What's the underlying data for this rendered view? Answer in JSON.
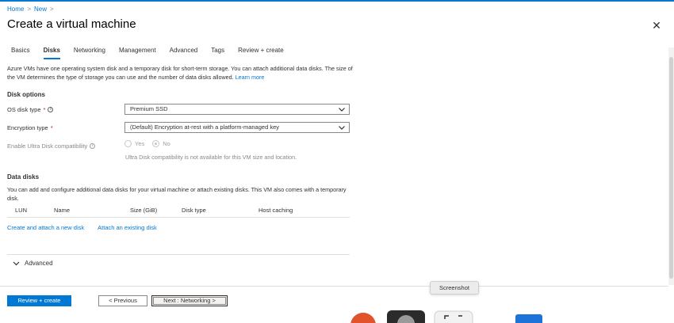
{
  "breadcrumb": {
    "items": [
      "Home",
      "New"
    ],
    "separator": ">"
  },
  "page_title": "Create a virtual machine",
  "close_symbol": "✕",
  "tabs": [
    {
      "label": "Basics",
      "active": false
    },
    {
      "label": "Disks",
      "active": true
    },
    {
      "label": "Networking",
      "active": false
    },
    {
      "label": "Management",
      "active": false
    },
    {
      "label": "Advanced",
      "active": false
    },
    {
      "label": "Tags",
      "active": false
    },
    {
      "label": "Review + create",
      "active": false
    }
  ],
  "description": {
    "text": "Azure VMs have one operating system disk and a temporary disk for short-term storage. You can attach additional data disks. The size of the VM determines the type of storage you can use and the number of data disks allowed.",
    "link": "Learn more"
  },
  "disk_options": {
    "heading": "Disk options",
    "os_disk_type": {
      "label": "OS disk type",
      "required_mark": "*",
      "value": "Premium SSD"
    },
    "encryption_type": {
      "label": "Encryption type",
      "required_mark": "*",
      "value": "(Default) Encryption at-rest with a platform-managed key"
    },
    "ultra_disk": {
      "label": "Enable Ultra Disk compatibility",
      "options": [
        "Yes",
        "No"
      ],
      "selected": "No",
      "note": "Ultra Disk compatibility is not available for this VM size and location."
    }
  },
  "data_disks": {
    "heading": "Data disks",
    "description": "You can add and configure additional data disks for your virtual machine or attach existing disks. This VM also comes with a temporary disk.",
    "columns": [
      "LUN",
      "Name",
      "Size (GiB)",
      "Disk type",
      "Host caching"
    ],
    "links": [
      "Create and attach a new disk",
      "Attach an existing disk"
    ]
  },
  "advanced_section": {
    "label": "Advanced"
  },
  "footer": {
    "review_create": "Review + create",
    "previous": "< Previous",
    "next": "Next : Networking >"
  },
  "tooltip": "Screenshot",
  "colors": {
    "accent": "#0078d4",
    "required": "#a4262c",
    "text": "#323130",
    "disabled": "#a19f9d"
  }
}
